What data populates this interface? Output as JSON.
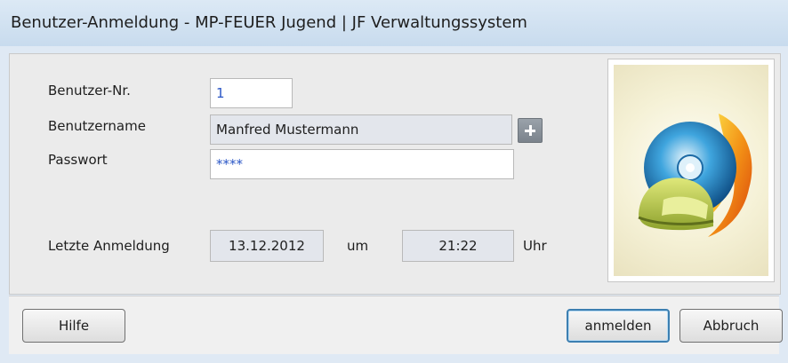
{
  "window": {
    "title": "Benutzer-Anmeldung - MP-FEUER Jugend | JF Verwaltungssystem"
  },
  "form": {
    "user_no_label": "Benutzer-Nr.",
    "user_no_value": "1",
    "username_label": "Benutzername",
    "username_value": "Manfred Mustermann",
    "password_label": "Passwort",
    "password_value": "****",
    "last_login_label": "Letzte Anmeldung",
    "last_login_date": "13.12.2012",
    "at_label": "um",
    "last_login_time": "21:22",
    "hour_label": "Uhr"
  },
  "buttons": {
    "help": "Hilfe",
    "login": "anmelden",
    "cancel": "Abbruch"
  },
  "icons": {
    "add_user": "plus-icon",
    "logo": "mp-feuer-logo"
  },
  "colors": {
    "accent": "#3c7fb1",
    "input_text": "#2a56c6"
  }
}
